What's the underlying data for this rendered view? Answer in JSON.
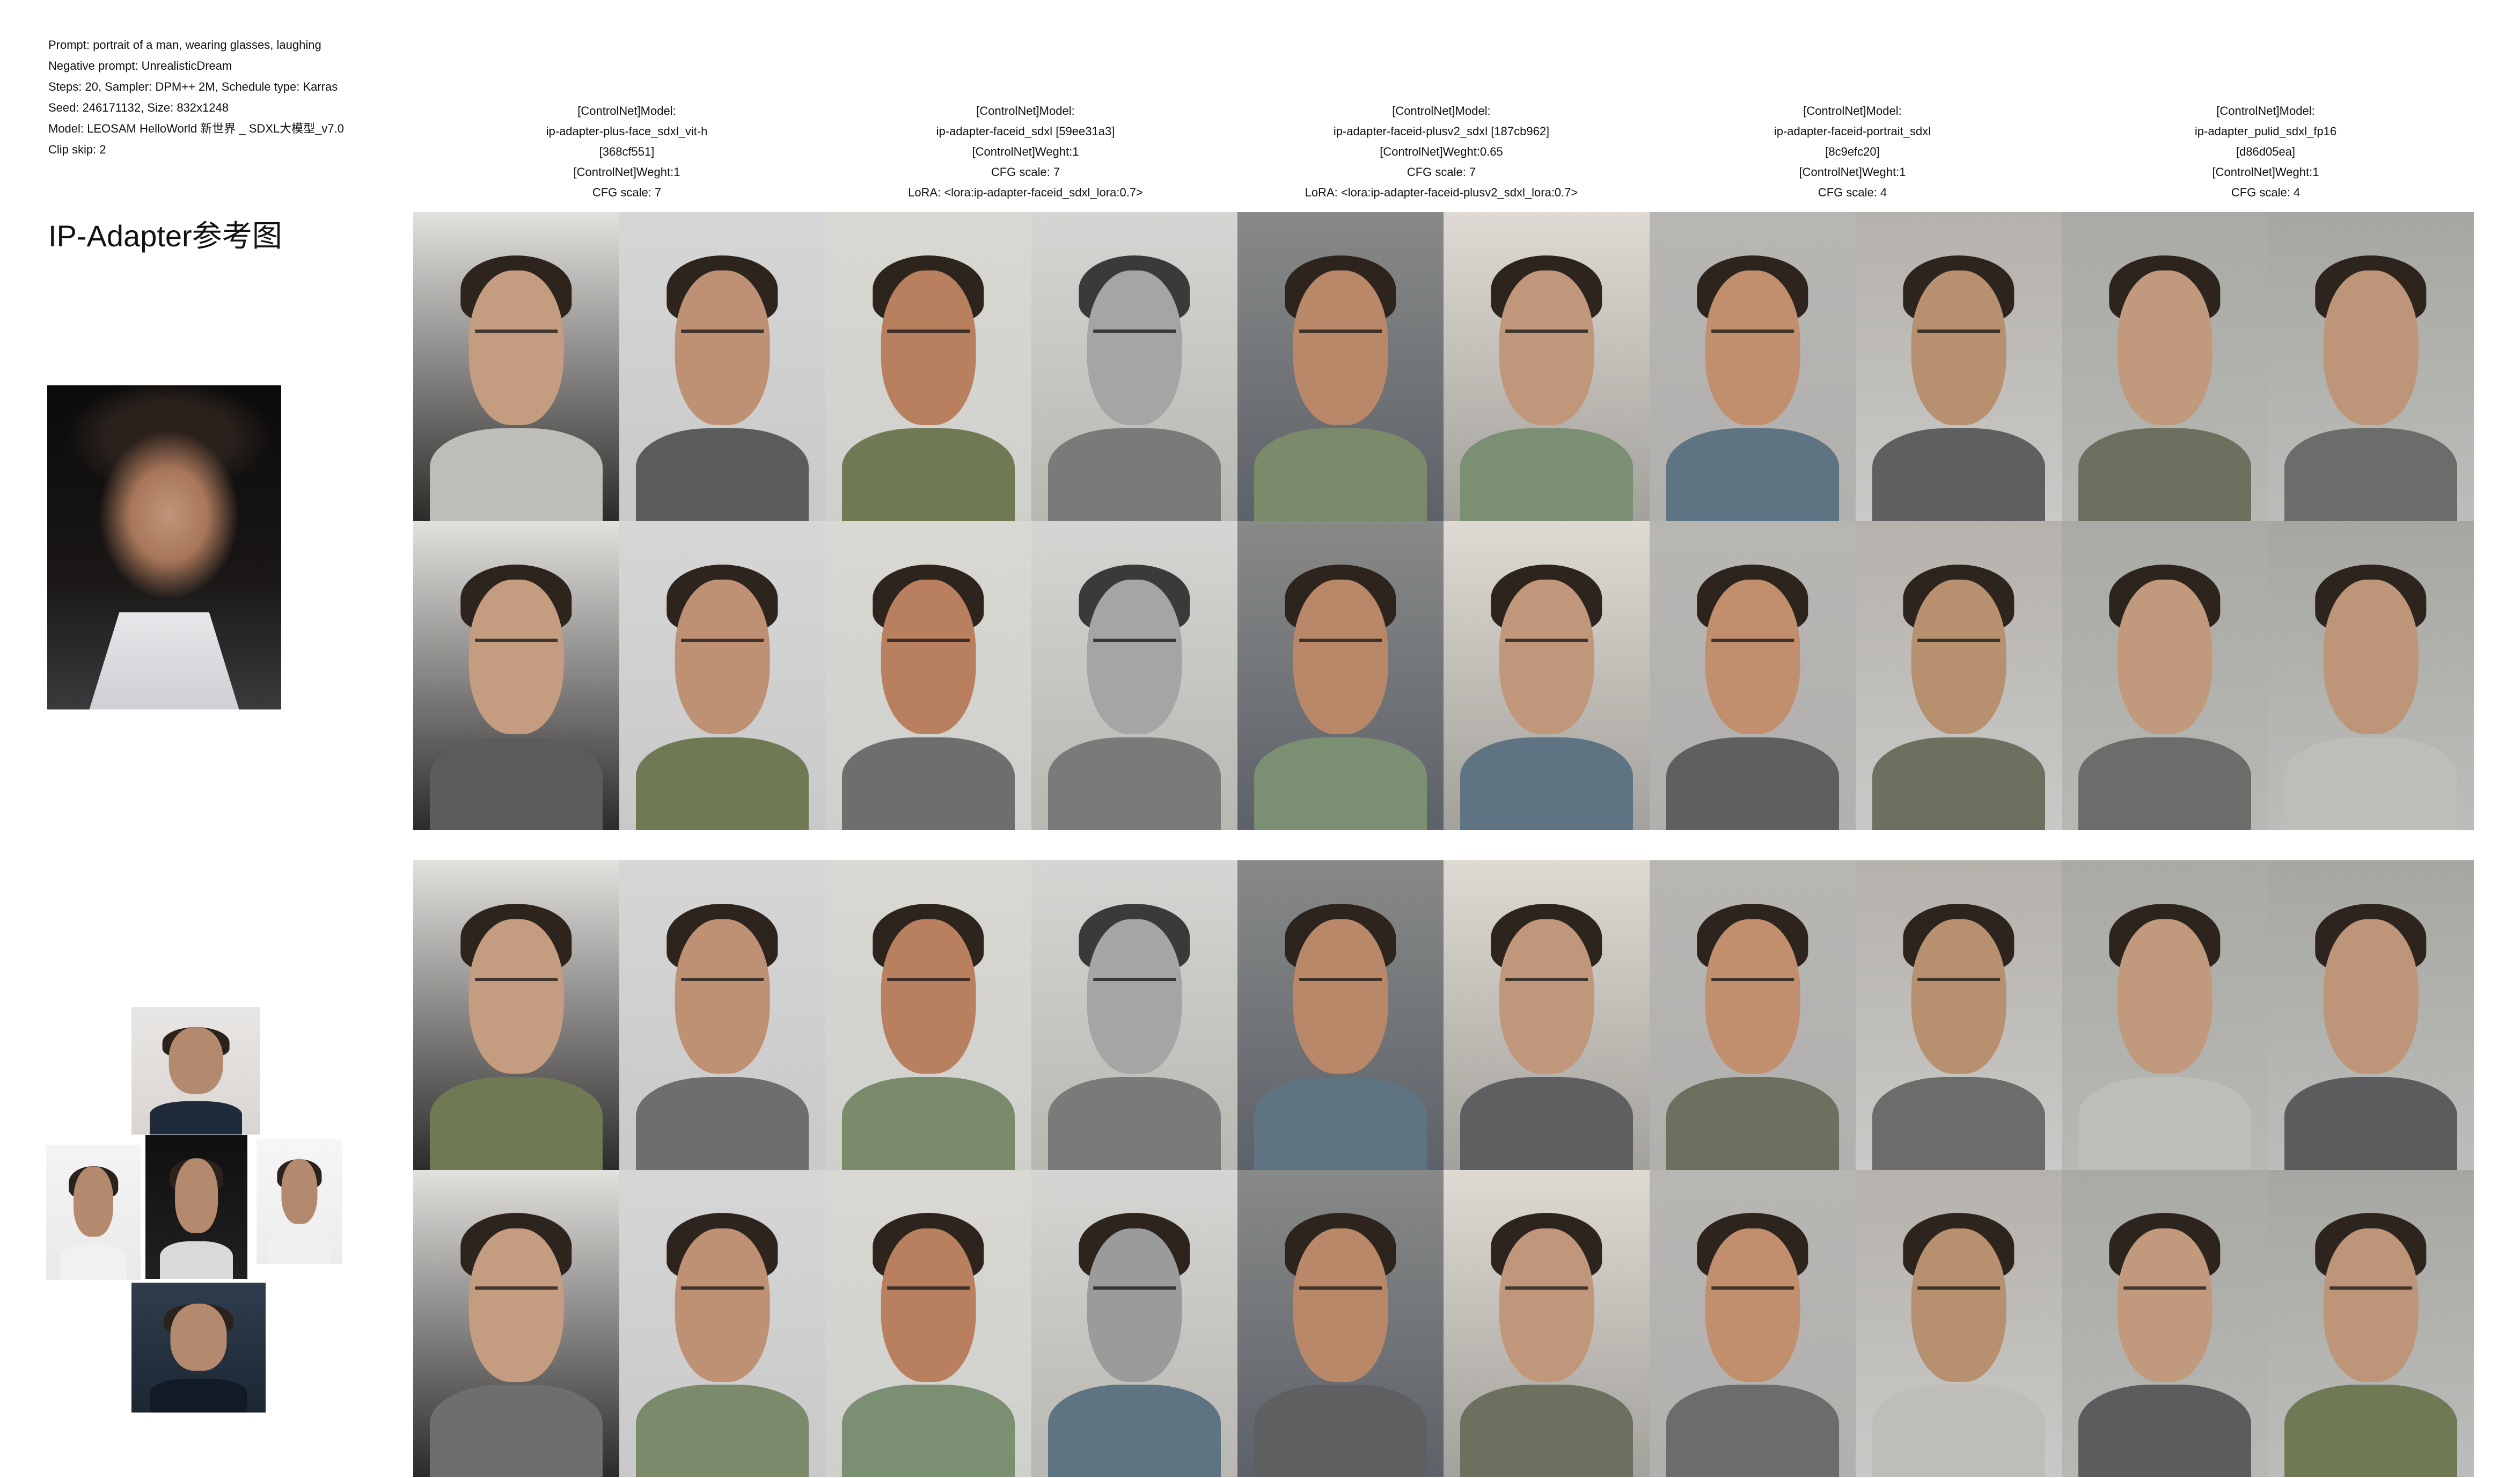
{
  "settings": {
    "lines": [
      "Prompt: portrait of a man, wearing glasses, laughing",
      "Negative prompt: UnrealisticDream",
      "Steps: 20, Sampler: DPM++ 2M, Schedule type: Karras",
      "Seed: 246171132, Size: 832x1248",
      "Model: LEOSAM HelloWorld 新世界 _ SDXL大模型_v7.0",
      "Clip skip: 2"
    ]
  },
  "reference": {
    "title": "IP-Adapter参考图"
  },
  "columns": [
    {
      "lines": [
        "[ControlNet]Model:",
        "ip-adapter-plus-face_sdxl_vit-h",
        "[368cf551]",
        "[ControlNet]Weght:1",
        "CFG scale: 7"
      ]
    },
    {
      "lines": [
        "[ControlNet]Model:",
        "ip-adapter-faceid_sdxl [59ee31a3]",
        "[ControlNet]Weght:1",
        "CFG scale: 7",
        "LoRA: <lora:ip-adapter-faceid_sdxl_lora:0.7>"
      ]
    },
    {
      "lines": [
        "[ControlNet]Model:",
        "ip-adapter-faceid-plusv2_sdxl [187cb962]",
        "[ControlNet]Weght:0.65",
        "CFG scale: 7",
        "LoRA: <lora:ip-adapter-faceid-plusv2_sdxl_lora:0.7>"
      ]
    },
    {
      "lines": [
        "[ControlNet]Model:",
        "ip-adapter-faceid-portrait_sdxl",
        "[8c9efc20]",
        "[ControlNet]Weght:1",
        "CFG scale: 4"
      ]
    },
    {
      "lines": [
        "[ControlNet]Model:",
        "ip-adapter_pulid_sdxl_fp16",
        "[d86d05ea]",
        "[ControlNet]Weght:1",
        "CFG scale: 4"
      ]
    }
  ],
  "colors": {
    "background": "#ffffff",
    "text": "#111111"
  }
}
